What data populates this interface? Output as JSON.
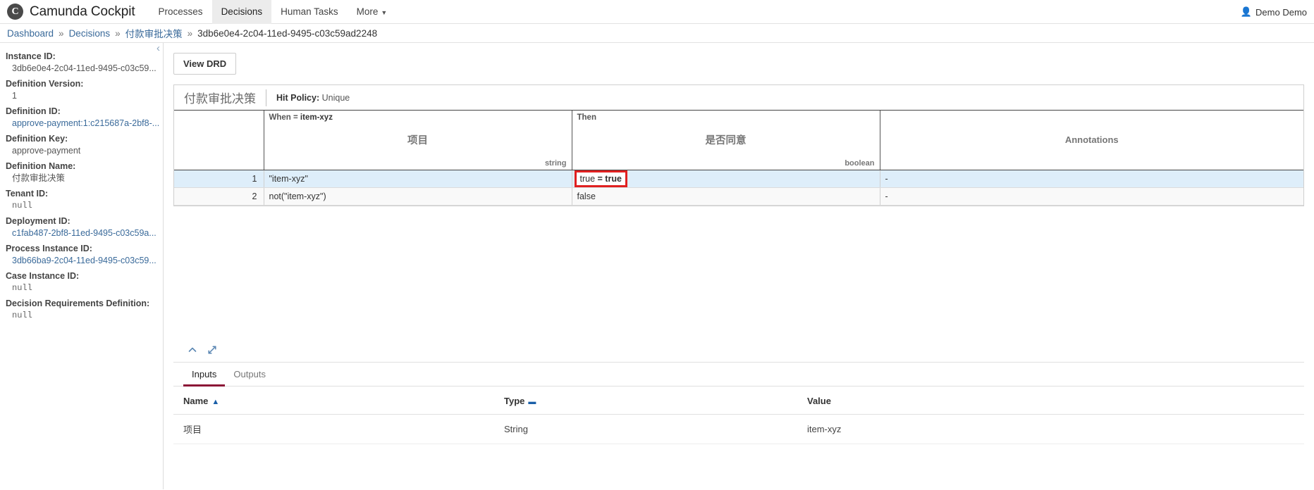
{
  "navbar": {
    "brand": "Camunda Cockpit",
    "logo_glyph": "C",
    "items": [
      {
        "label": "Processes",
        "active": false
      },
      {
        "label": "Decisions",
        "active": true
      },
      {
        "label": "Human Tasks",
        "active": false
      },
      {
        "label": "More",
        "active": false,
        "caret": "▼"
      }
    ],
    "user": "Demo Demo",
    "user_icon": "👤"
  },
  "breadcrumb": {
    "separator": "»",
    "items": [
      {
        "label": "Dashboard",
        "link": true
      },
      {
        "label": "Decisions",
        "link": true
      },
      {
        "label": "付款审批决策",
        "link": true
      },
      {
        "label": "3db6e0e4-2c04-11ed-9495-c03c59ad2248",
        "link": false
      }
    ]
  },
  "sidebar": {
    "collapse_icon": "‹",
    "properties": [
      {
        "label": "Instance ID:",
        "value": "3db6e0e4-2c04-11ed-9495-c03c59...",
        "style": "plain"
      },
      {
        "label": "Definition Version:",
        "value": "1",
        "style": "plain"
      },
      {
        "label": "Definition ID:",
        "value": "approve-payment:1:c215687a-2bf8-...",
        "style": "link"
      },
      {
        "label": "Definition Key:",
        "value": "approve-payment",
        "style": "plain"
      },
      {
        "label": "Definition Name:",
        "value": "付款审批决策",
        "style": "plain"
      },
      {
        "label": "Tenant ID:",
        "value": "null",
        "style": "mono"
      },
      {
        "label": "Deployment ID:",
        "value": "c1fab487-2bf8-11ed-9495-c03c59a...",
        "style": "link"
      },
      {
        "label": "Process Instance ID:",
        "value": "3db66ba9-2c04-11ed-9495-c03c59...",
        "style": "link"
      },
      {
        "label": "Case Instance ID:",
        "value": "null",
        "style": "mono"
      },
      {
        "label": "Decision Requirements Definition:",
        "value": "null",
        "style": "mono"
      }
    ]
  },
  "main": {
    "view_drd_label": "View DRD",
    "decision_table": {
      "name": "付款审批决策",
      "hit_policy_label": "Hit Policy:",
      "hit_policy_value": "Unique",
      "columns": [
        {
          "tag": "",
          "tag_value": "",
          "title": "",
          "type": ""
        },
        {
          "tag": "When =",
          "tag_value": "item-xyz",
          "title": "项目",
          "type": "string"
        },
        {
          "tag": "Then",
          "tag_value": "",
          "title": "是否同意",
          "type": "boolean"
        },
        {
          "tag": "",
          "tag_value": "",
          "title": "Annotations",
          "type": ""
        }
      ],
      "rules": [
        {
          "index": "1",
          "input": "\"item-xyz\"",
          "output": "true = true",
          "output_prefix": "true ",
          "output_bold": "= true",
          "annotation": "-",
          "highlighted": true
        },
        {
          "index": "2",
          "input": "not(\"item-xyz\")",
          "output": "false",
          "output_prefix": "false",
          "output_bold": "",
          "annotation": "-",
          "highlighted": false
        }
      ]
    },
    "toolbar": {
      "collapse_label": "chevron-up",
      "expand_label": "expand"
    },
    "tabs": [
      {
        "label": "Inputs",
        "active": true
      },
      {
        "label": "Outputs",
        "active": false
      }
    ],
    "io_table": {
      "headers": [
        {
          "label": "Name",
          "sort": "▲"
        },
        {
          "label": "Type",
          "sort": "▬"
        },
        {
          "label": "Value",
          "sort": ""
        }
      ],
      "rows": [
        {
          "name": "项目",
          "type": "String",
          "value": "item-xyz"
        }
      ]
    }
  },
  "colors": {
    "accent_tab": "#8b1436",
    "highlight_row": "#deeefa",
    "highlight_outline": "#e02020",
    "link": "#3a6a9a"
  }
}
